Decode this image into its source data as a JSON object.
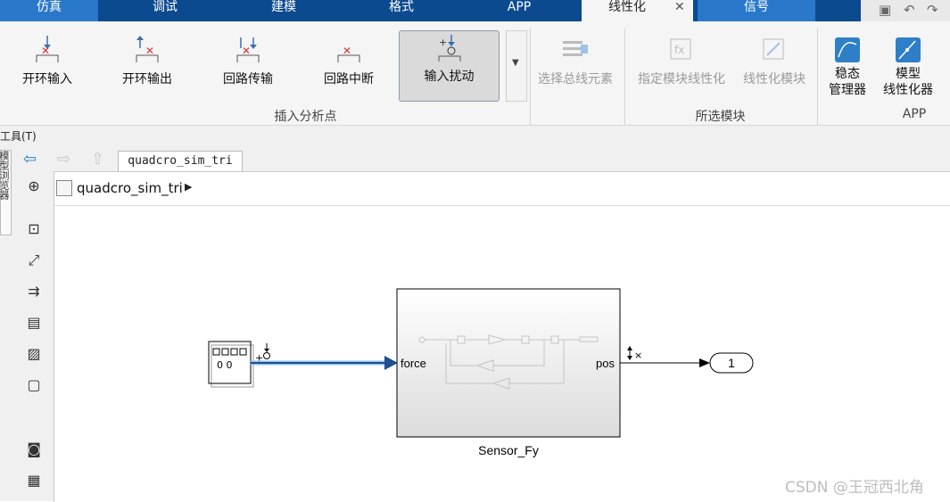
{
  "tabs": [
    {
      "label": "仿真"
    },
    {
      "label": "调试"
    },
    {
      "label": "建模"
    },
    {
      "label": "格式"
    },
    {
      "label": "APP"
    },
    {
      "label": "线性化"
    },
    {
      "label": "信号"
    }
  ],
  "tab_close": "✕",
  "ribbon": {
    "open_loop_input": "开环输入",
    "open_loop_output": "开环输出",
    "loop_transfer": "回路传输",
    "loop_break": "回路中断",
    "input_perturbation": "输入扰动",
    "group_insert": "插入分析点",
    "select_bus_elements": "选择总线元素",
    "specify_block_lin": "指定模块线性化",
    "linearize_block": "线性化模块",
    "group_selected": "所选模块",
    "steady_state_1": "稳态",
    "steady_state_2": "管理器",
    "model_lin_1": "模型",
    "model_lin_2": "线性化器",
    "group_app": "APP"
  },
  "menu": {
    "tools": "工具(T)"
  },
  "left_panel_label": "模型浏览器",
  "editor_tab": "quadcro_sim_tri",
  "breadcrumb": "quadcro_sim_tri",
  "blocks": {
    "source_display": "0 0",
    "subsystem_name": "Sensor_Fy",
    "input_port": "force",
    "output_port": "pos",
    "outport_number": "1",
    "perturb_mark": "+⭘",
    "output_mark": "↕×"
  },
  "watermark": "CSDN @王冠西北角"
}
